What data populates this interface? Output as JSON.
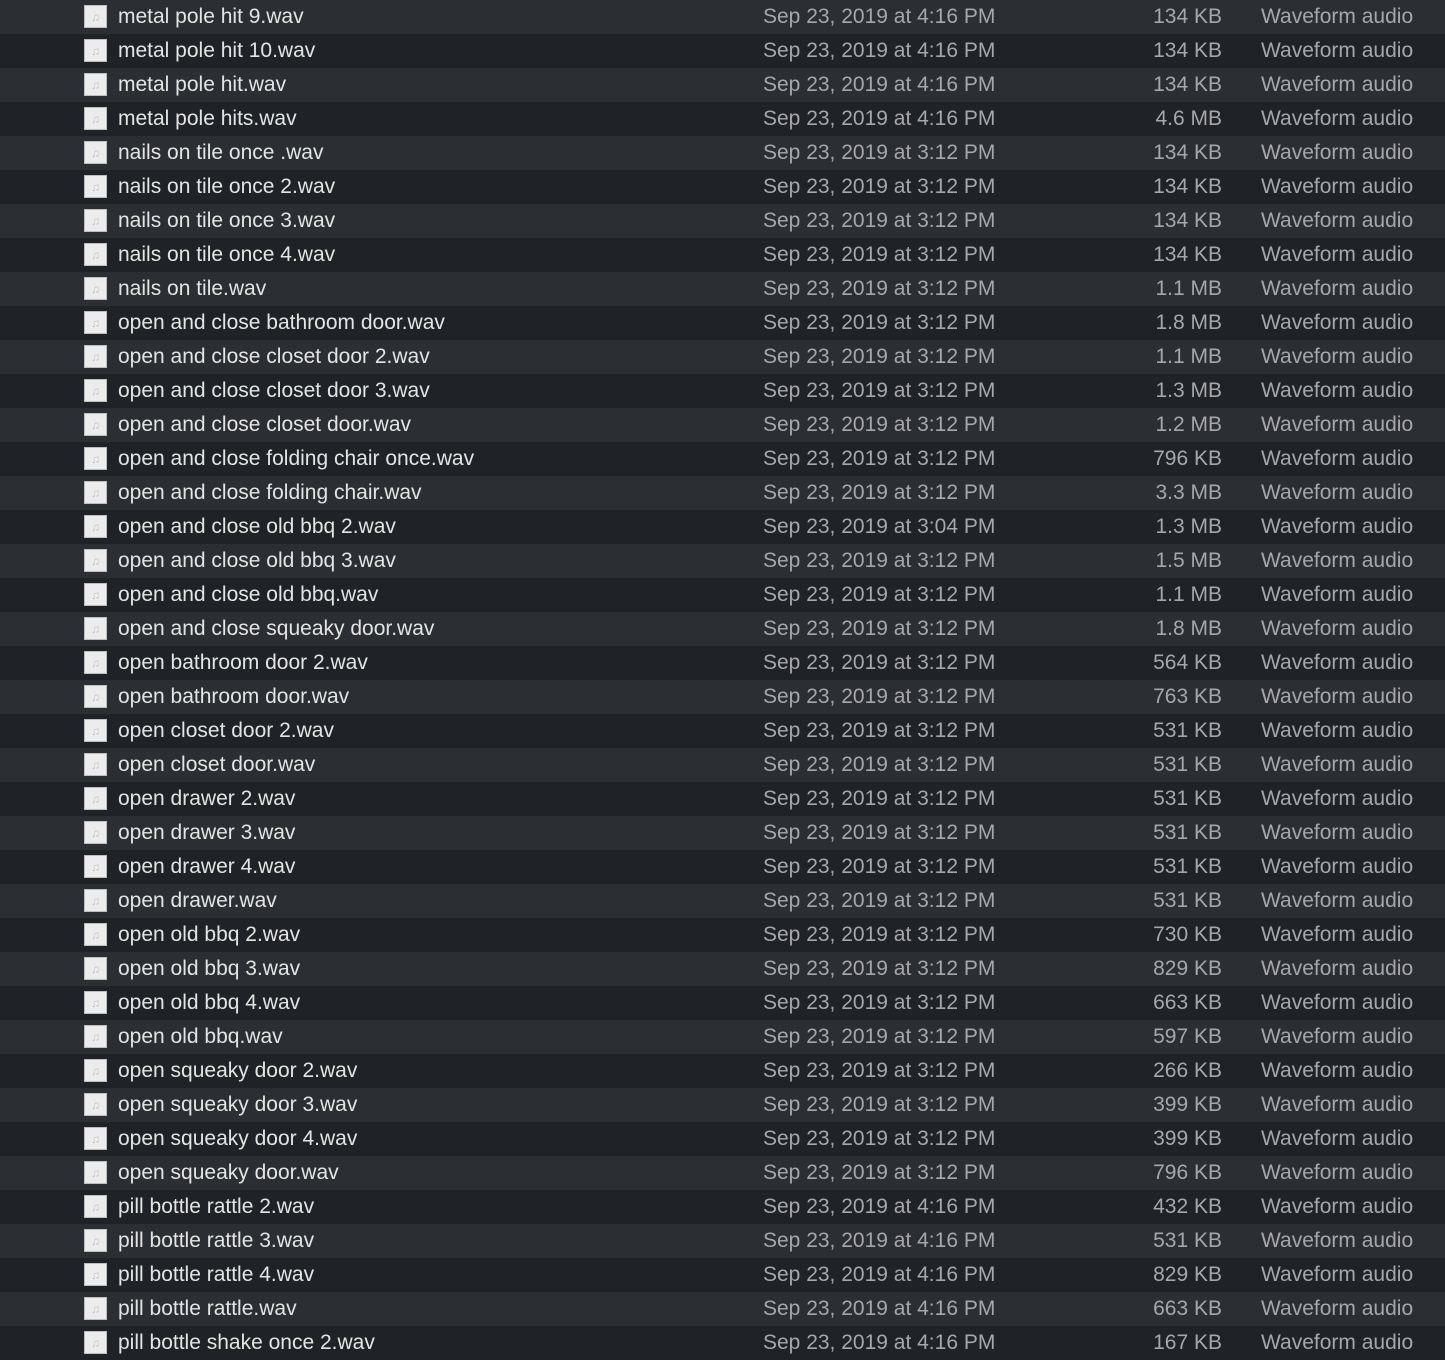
{
  "colors": {
    "row_light": "#2b2e33",
    "row_dark": "#1f2226",
    "name_text": "#e4e4e4",
    "meta_text": "#a7a7a9"
  },
  "file_icon": "audio-file-icon",
  "files": [
    {
      "name": "metal pole hit 9.wav",
      "date": "Sep 23, 2019 at 4:16 PM",
      "size": "134 KB",
      "kind": "Waveform audio"
    },
    {
      "name": "metal pole hit 10.wav",
      "date": "Sep 23, 2019 at 4:16 PM",
      "size": "134 KB",
      "kind": "Waveform audio"
    },
    {
      "name": "metal pole hit.wav",
      "date": "Sep 23, 2019 at 4:16 PM",
      "size": "134 KB",
      "kind": "Waveform audio"
    },
    {
      "name": "metal pole hits.wav",
      "date": "Sep 23, 2019 at 4:16 PM",
      "size": "4.6 MB",
      "kind": "Waveform audio"
    },
    {
      "name": "nails on tile once .wav",
      "date": "Sep 23, 2019 at 3:12 PM",
      "size": "134 KB",
      "kind": "Waveform audio"
    },
    {
      "name": "nails on tile once 2.wav",
      "date": "Sep 23, 2019 at 3:12 PM",
      "size": "134 KB",
      "kind": "Waveform audio"
    },
    {
      "name": "nails on tile once 3.wav",
      "date": "Sep 23, 2019 at 3:12 PM",
      "size": "134 KB",
      "kind": "Waveform audio"
    },
    {
      "name": "nails on tile once 4.wav",
      "date": "Sep 23, 2019 at 3:12 PM",
      "size": "134 KB",
      "kind": "Waveform audio"
    },
    {
      "name": "nails on tile.wav",
      "date": "Sep 23, 2019 at 3:12 PM",
      "size": "1.1 MB",
      "kind": "Waveform audio"
    },
    {
      "name": "open and close bathroom door.wav",
      "date": "Sep 23, 2019 at 3:12 PM",
      "size": "1.8 MB",
      "kind": "Waveform audio"
    },
    {
      "name": "open and close closet door 2.wav",
      "date": "Sep 23, 2019 at 3:12 PM",
      "size": "1.1 MB",
      "kind": "Waveform audio"
    },
    {
      "name": "open and close closet door 3.wav",
      "date": "Sep 23, 2019 at 3:12 PM",
      "size": "1.3 MB",
      "kind": "Waveform audio"
    },
    {
      "name": "open and close closet door.wav",
      "date": "Sep 23, 2019 at 3:12 PM",
      "size": "1.2 MB",
      "kind": "Waveform audio"
    },
    {
      "name": "open and close folding chair once.wav",
      "date": "Sep 23, 2019 at 3:12 PM",
      "size": "796 KB",
      "kind": "Waveform audio"
    },
    {
      "name": "open and close folding chair.wav",
      "date": "Sep 23, 2019 at 3:12 PM",
      "size": "3.3 MB",
      "kind": "Waveform audio"
    },
    {
      "name": "open and close old bbq 2.wav",
      "date": "Sep 23, 2019 at 3:04 PM",
      "size": "1.3 MB",
      "kind": "Waveform audio"
    },
    {
      "name": "open and close old bbq 3.wav",
      "date": "Sep 23, 2019 at 3:12 PM",
      "size": "1.5 MB",
      "kind": "Waveform audio"
    },
    {
      "name": "open and close old bbq.wav",
      "date": "Sep 23, 2019 at 3:12 PM",
      "size": "1.1 MB",
      "kind": "Waveform audio"
    },
    {
      "name": "open and close squeaky door.wav",
      "date": "Sep 23, 2019 at 3:12 PM",
      "size": "1.8 MB",
      "kind": "Waveform audio"
    },
    {
      "name": "open bathroom door 2.wav",
      "date": "Sep 23, 2019 at 3:12 PM",
      "size": "564 KB",
      "kind": "Waveform audio"
    },
    {
      "name": "open bathroom door.wav",
      "date": "Sep 23, 2019 at 3:12 PM",
      "size": "763 KB",
      "kind": "Waveform audio"
    },
    {
      "name": "open closet door 2.wav",
      "date": "Sep 23, 2019 at 3:12 PM",
      "size": "531 KB",
      "kind": "Waveform audio"
    },
    {
      "name": "open closet door.wav",
      "date": "Sep 23, 2019 at 3:12 PM",
      "size": "531 KB",
      "kind": "Waveform audio"
    },
    {
      "name": "open drawer 2.wav",
      "date": "Sep 23, 2019 at 3:12 PM",
      "size": "531 KB",
      "kind": "Waveform audio"
    },
    {
      "name": "open drawer 3.wav",
      "date": "Sep 23, 2019 at 3:12 PM",
      "size": "531 KB",
      "kind": "Waveform audio"
    },
    {
      "name": "open drawer 4.wav",
      "date": "Sep 23, 2019 at 3:12 PM",
      "size": "531 KB",
      "kind": "Waveform audio"
    },
    {
      "name": "open drawer.wav",
      "date": "Sep 23, 2019 at 3:12 PM",
      "size": "531 KB",
      "kind": "Waveform audio"
    },
    {
      "name": "open old bbq 2.wav",
      "date": "Sep 23, 2019 at 3:12 PM",
      "size": "730 KB",
      "kind": "Waveform audio"
    },
    {
      "name": "open old bbq 3.wav",
      "date": "Sep 23, 2019 at 3:12 PM",
      "size": "829 KB",
      "kind": "Waveform audio"
    },
    {
      "name": "open old bbq 4.wav",
      "date": "Sep 23, 2019 at 3:12 PM",
      "size": "663 KB",
      "kind": "Waveform audio"
    },
    {
      "name": "open old bbq.wav",
      "date": "Sep 23, 2019 at 3:12 PM",
      "size": "597 KB",
      "kind": "Waveform audio"
    },
    {
      "name": "open squeaky door 2.wav",
      "date": "Sep 23, 2019 at 3:12 PM",
      "size": "266 KB",
      "kind": "Waveform audio"
    },
    {
      "name": "open squeaky door 3.wav",
      "date": "Sep 23, 2019 at 3:12 PM",
      "size": "399 KB",
      "kind": "Waveform audio"
    },
    {
      "name": "open squeaky door 4.wav",
      "date": "Sep 23, 2019 at 3:12 PM",
      "size": "399 KB",
      "kind": "Waveform audio"
    },
    {
      "name": "open squeaky door.wav",
      "date": "Sep 23, 2019 at 3:12 PM",
      "size": "796 KB",
      "kind": "Waveform audio"
    },
    {
      "name": "pill bottle rattle 2.wav",
      "date": "Sep 23, 2019 at 4:16 PM",
      "size": "432 KB",
      "kind": "Waveform audio"
    },
    {
      "name": "pill bottle rattle 3.wav",
      "date": "Sep 23, 2019 at 4:16 PM",
      "size": "531 KB",
      "kind": "Waveform audio"
    },
    {
      "name": "pill bottle rattle 4.wav",
      "date": "Sep 23, 2019 at 4:16 PM",
      "size": "829 KB",
      "kind": "Waveform audio"
    },
    {
      "name": "pill bottle rattle.wav",
      "date": "Sep 23, 2019 at 4:16 PM",
      "size": "663 KB",
      "kind": "Waveform audio"
    },
    {
      "name": "pill bottle shake once 2.wav",
      "date": "Sep 23, 2019 at 4:16 PM",
      "size": "167 KB",
      "kind": "Waveform audio"
    }
  ]
}
